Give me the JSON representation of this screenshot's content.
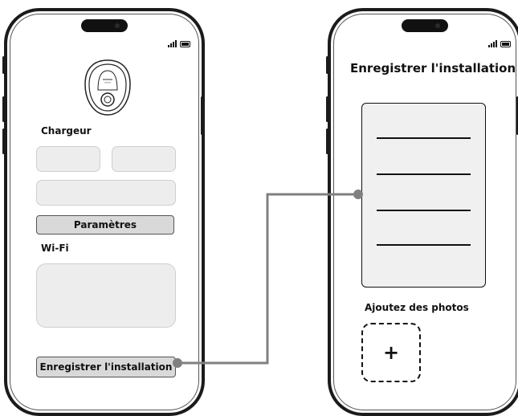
{
  "left_screen": {
    "charger_label": "Chargeur",
    "settings_button": "Paramètres",
    "wifi_label": "Wi-Fi",
    "register_button": "Enregistrer l'installation"
  },
  "right_screen": {
    "title": "Enregistrer l'installation",
    "photos_label": "Ajoutez des photos",
    "add_photo_symbol": "+"
  },
  "colors": {
    "connector": "#808080",
    "field_fill": "#ededed",
    "button_fill": "#d9d9d9",
    "frame": "#1b1b1b"
  },
  "icons": [
    "signal-icon",
    "battery-icon",
    "charger-device-icon",
    "plus-icon"
  ]
}
